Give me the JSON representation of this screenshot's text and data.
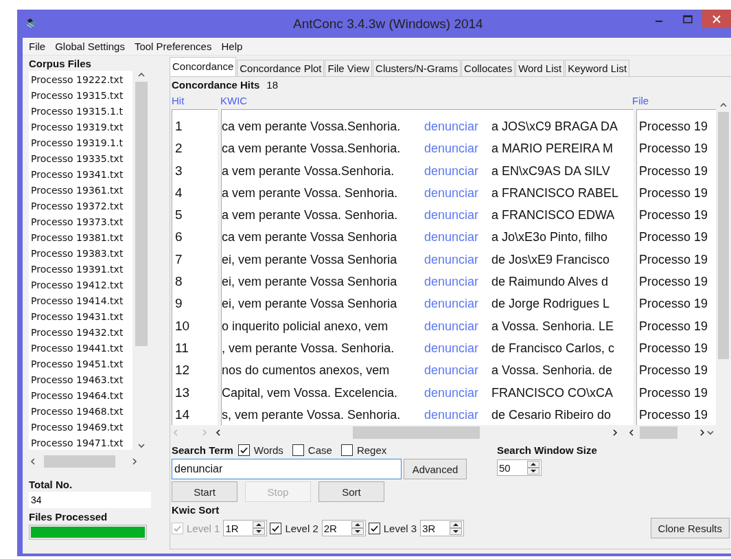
{
  "window": {
    "title": "AntConc 3.4.3w (Windows) 2014"
  },
  "menu": [
    "File",
    "Global Settings",
    "Tool Preferences",
    "Help"
  ],
  "corpus": {
    "label": "Corpus Files",
    "files": [
      "Processo 19222.txt",
      "Processo 19315.txt",
      "Processo 19315.1.t",
      "Processo 19319.txt",
      "Processo 19319.1.t",
      "Processo 19335.txt",
      "Processo 19341.txt",
      "Processo 19361.txt",
      "Processo 19372.txt",
      "Processo 19373.txt",
      "Processo 19381.txt",
      "Processo 19383.txt",
      "Processo 19391.txt",
      "Processo 19412.txt",
      "Processo 19414.txt",
      "Processo 19431.txt",
      "Processo 19432.txt",
      "Processo 19441.txt",
      "Processo 19451.txt",
      "Processo 19463.txt",
      "Processo 19464.txt",
      "Processo 19468.txt",
      "Processo 19469.txt",
      "Processo 19471.txt"
    ],
    "total_label": "Total No.",
    "total": "34",
    "processed_label": "Files Processed",
    "level": 1
  },
  "tabs": [
    {
      "label": "Concordance",
      "selected": true
    },
    {
      "label": "Concordance Plot",
      "selected": false
    },
    {
      "label": "File View",
      "selected": false
    },
    {
      "label": "Clusters/N-Grams",
      "selected": false
    },
    {
      "label": "Collocates",
      "selected": false
    },
    {
      "label": "Word List",
      "selected": false
    },
    {
      "label": "Keyword List",
      "selected": false
    }
  ],
  "hits": {
    "label": "Concordance Hits",
    "count": "18"
  },
  "columns": [
    "Hit",
    "KWIC",
    "File"
  ],
  "rows": [
    {
      "hit": "1",
      "left": "ca vem perante Vossa.Senhoria.",
      "keyword": "denunciar",
      "right": "a JOS\\xC9 BRAGA DA",
      "file": "Processo 19"
    },
    {
      "hit": "2",
      "left": "ca vem perante Vossa.Senhoria.",
      "keyword": "denunciar",
      "right": "a MARIO PEREIRA M",
      "file": "Processo 19"
    },
    {
      "hit": "3",
      "left": "a vem perante Vossa.Senhoria.",
      "keyword": "denunciar",
      "right": "a EN\\xC9AS DA SILV",
      "file": "Processo 19"
    },
    {
      "hit": "4",
      "left": "a vem perante Vossa. Senhoria.",
      "keyword": "denunciar",
      "right": "a FRANCISCO RABEL",
      "file": "Processo 19"
    },
    {
      "hit": "5",
      "left": "a vem perante Vossa. Senhoria.",
      "keyword": "denunciar",
      "right": "a FRANCISCO EDWA",
      "file": "Processo 19"
    },
    {
      "hit": "6",
      "left": "ca vem perante Vossa Senhoria",
      "keyword": "denunciar",
      "right": "a Jo\\xE3o Pinto, filho",
      "file": "Processo 19"
    },
    {
      "hit": "7",
      "left": "ei, vem perante Vossa Senhoria",
      "keyword": "denunciar",
      "right": "de Jos\\xE9 Francisco",
      "file": "Processo 19"
    },
    {
      "hit": "8",
      "left": "ei, vem  perante Vossa Senhoria",
      "keyword": "denunciar",
      "right": "de Raimundo Alves d",
      "file": "Processo 19"
    },
    {
      "hit": "9",
      "left": "ei, vem perante Vossa Senhoria",
      "keyword": "denunciar",
      "right": "de Jorge Rodrigues L",
      "file": "Processo 19"
    },
    {
      "hit": "10",
      "left": "o inquerito policial anexo, vem",
      "keyword": "denunciar",
      "right": "a Vossa. Senhoria. LE",
      "file": "Processo 19"
    },
    {
      "hit": "11",
      "left": ", vem  perante Vossa. Senhoria.",
      "keyword": "denunciar",
      "right": "de Francisco Carlos, c",
      "file": "Processo 19"
    },
    {
      "hit": "12",
      "left": "nos do  cumentos anexos, vem",
      "keyword": "denunciar",
      "right": "a Vossa. Senhoria. de",
      "file": "Processo 19"
    },
    {
      "hit": "13",
      "left": "Capital, vem Vossa. Excelencia.",
      "keyword": "denunciar",
      "right": "FRANCISCO CO\\xCA",
      "file": "Processo 19"
    },
    {
      "hit": "14",
      "left": "s, vem perante Vossa. Senhoria.",
      "keyword": "denunciar",
      "right": "de Cesario Ribeiro do",
      "file": "Processo 19"
    }
  ],
  "search": {
    "label": "Search Term",
    "options": [
      {
        "label": "Words",
        "checked": true
      },
      {
        "label": "Case",
        "checked": false
      },
      {
        "label": "Regex",
        "checked": false
      }
    ],
    "value": "denunciar",
    "advanced": "Advanced",
    "window_label": "Search Window Size",
    "window_size": "50"
  },
  "buttons": [
    {
      "label": "Start",
      "disabled": false
    },
    {
      "label": "Stop",
      "disabled": true
    },
    {
      "label": "Sort",
      "disabled": false
    }
  ],
  "kwic_sort": {
    "label": "Kwic Sort",
    "levels": [
      {
        "label": "Level 1",
        "checked": true,
        "disabled": true,
        "value": "1R"
      },
      {
        "label": "Level 2",
        "checked": true,
        "disabled": false,
        "value": "2R"
      },
      {
        "label": "Level 3",
        "checked": true,
        "disabled": false,
        "value": "3R"
      }
    ]
  },
  "clone": "Clone Results"
}
